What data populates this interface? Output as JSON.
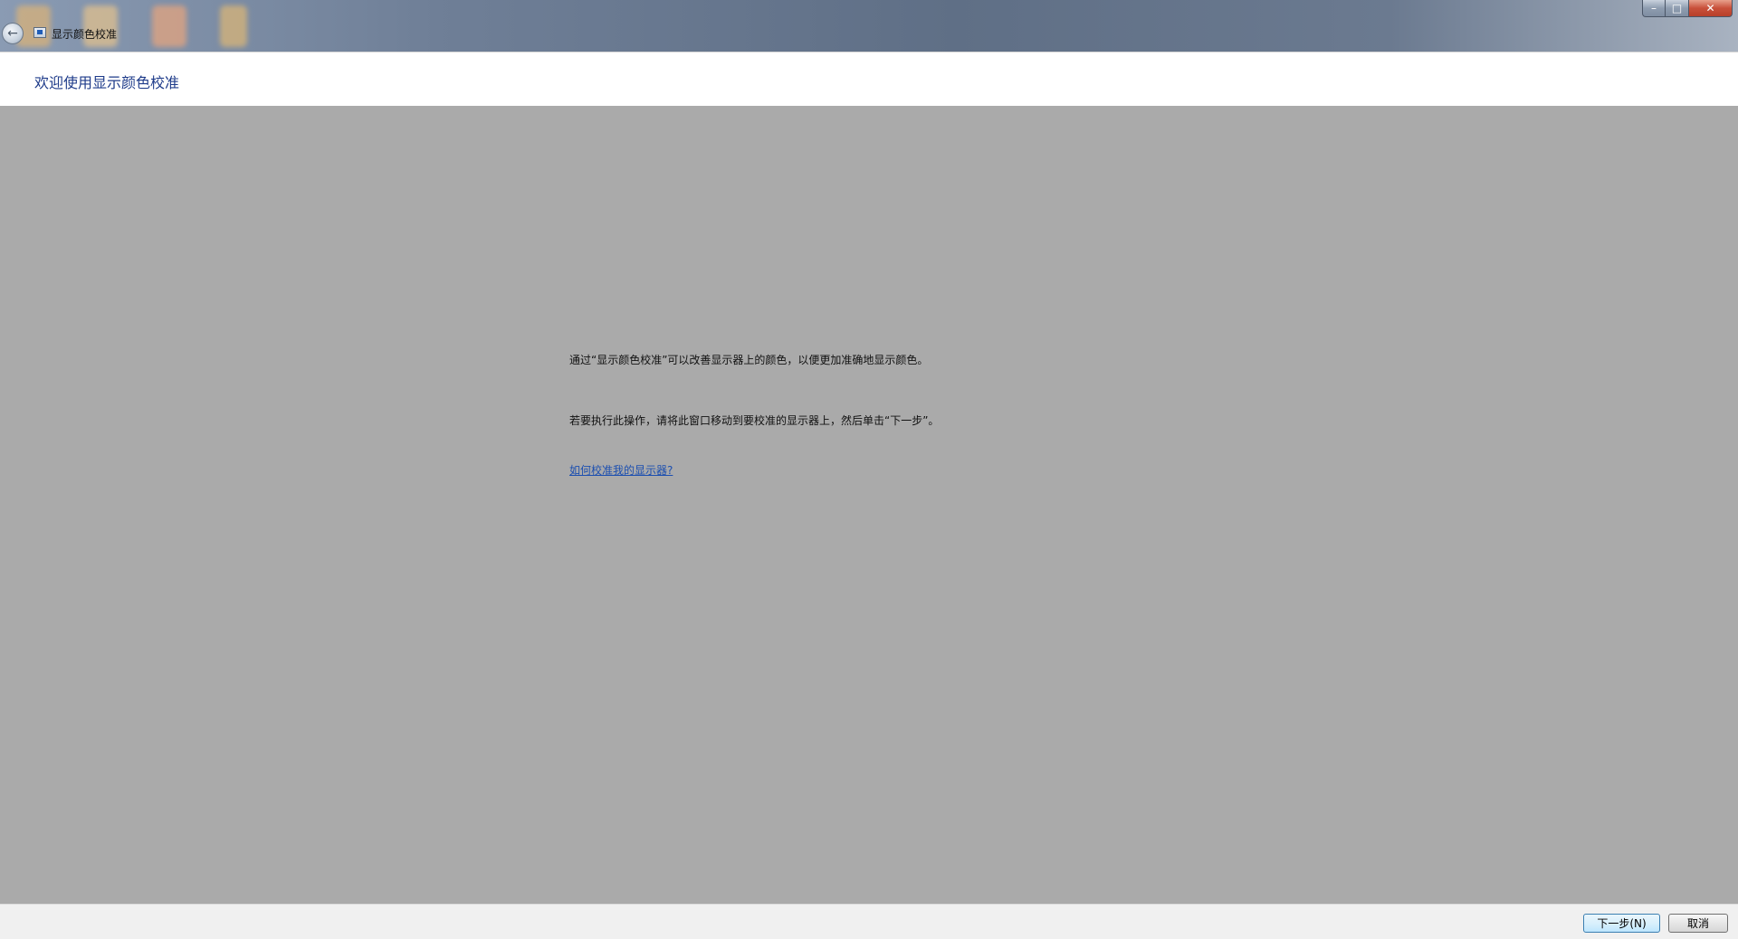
{
  "window": {
    "title": "显示颜色校准",
    "caption": {
      "minimize": "–",
      "maximize": "□",
      "close": "✕"
    },
    "icons": {
      "back": "back-arrow-icon",
      "app": "display-color-calibration-icon"
    }
  },
  "header": {
    "title": "欢迎使用显示颜色校准"
  },
  "main": {
    "paragraph_1": "通过“显示颜色校准”可以改善显示器上的颜色，以便更加准确地显示颜色。",
    "paragraph_2": "若要执行此操作，请将此窗口移动到要校准的显示器上，然后单击“下一步”。",
    "help_link": "如何校准我的显示器?"
  },
  "footer": {
    "next_label": "下一步(N)",
    "cancel_label": "取消"
  },
  "colors": {
    "content_background": "#aaaaaa",
    "title_text": "#1e3b8a",
    "link": "#1c4fb0"
  }
}
